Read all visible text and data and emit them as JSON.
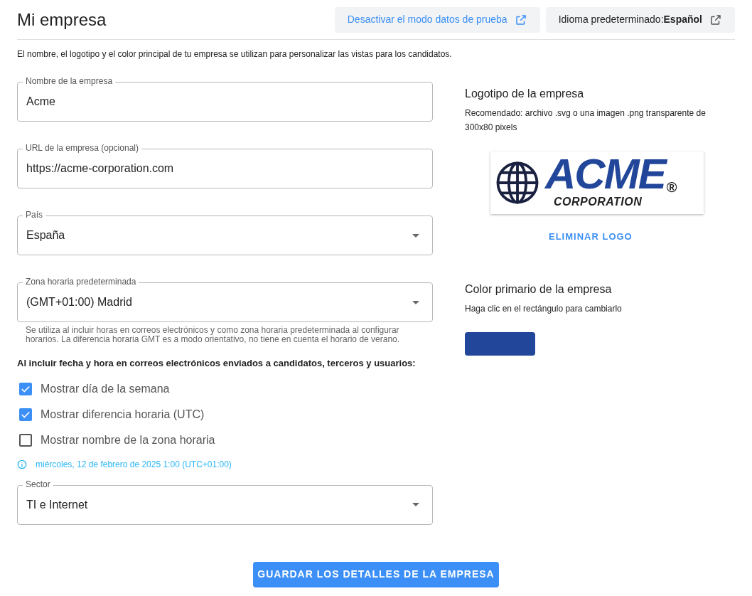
{
  "header": {
    "title": "Mi empresa",
    "buttons": [
      {
        "kind": "link",
        "label": "Desactivar el modo datos de prueba"
      },
      {
        "kind": "language",
        "label": "Idioma predeterminado:",
        "value": "Español"
      }
    ]
  },
  "intro": "El nombre, el logotipo y el color principal de tu empresa se utilizan para personalizar las vistas para los candidatos.",
  "fields": [
    {
      "kind": "text",
      "label": "Nombre de la empresa",
      "value": "Acme"
    },
    {
      "kind": "text",
      "label": "URL de la empresa (opcional)",
      "value": "https://acme-corporation.com"
    },
    {
      "kind": "select",
      "label": "País",
      "value": "España"
    },
    {
      "kind": "select",
      "label": "Zona horaria predeterminada",
      "value": "(GMT+01:00) Madrid",
      "helper": "Se utiliza al incluir horas en correos electrónicos y como zona horaria predeterminada al configurar horarios. La diferencia horaria GMT es a modo orientativo, no tiene en cuenta el horario de verano."
    }
  ],
  "date_options": {
    "heading": "Al incluir fecha y hora en correos electrónicos enviados a candidatos, terceros y usuarios:",
    "options": [
      {
        "label": "Mostrar día de la semana",
        "checked": true
      },
      {
        "label": "Mostrar diferencia horaria (UTC)",
        "checked": true
      },
      {
        "label": "Mostrar nombre de la zona horaria",
        "checked": false
      }
    ],
    "preview": "miércoles, 12 de febrero de 2025 1:00 (UTC+01:00)"
  },
  "sector": {
    "kind": "select",
    "label": "Sector",
    "value": "TI e Internet"
  },
  "logo": {
    "title": "Logotipo de la empresa",
    "hint": "Recomendado: archivo .svg o una imagen .png transparente de 300x80 pixels",
    "wordmark": "ACME",
    "registered": "®",
    "subtitle": "CORPORATION",
    "remove": "ELIMINAR LOGO"
  },
  "color": {
    "title": "Color primario de la empresa",
    "hint": "Haga clic en el rectángulo para cambiarlo",
    "color": "#22479a"
  },
  "save": "GUARDAR LOS DETALLES DE LA EMPRESA"
}
